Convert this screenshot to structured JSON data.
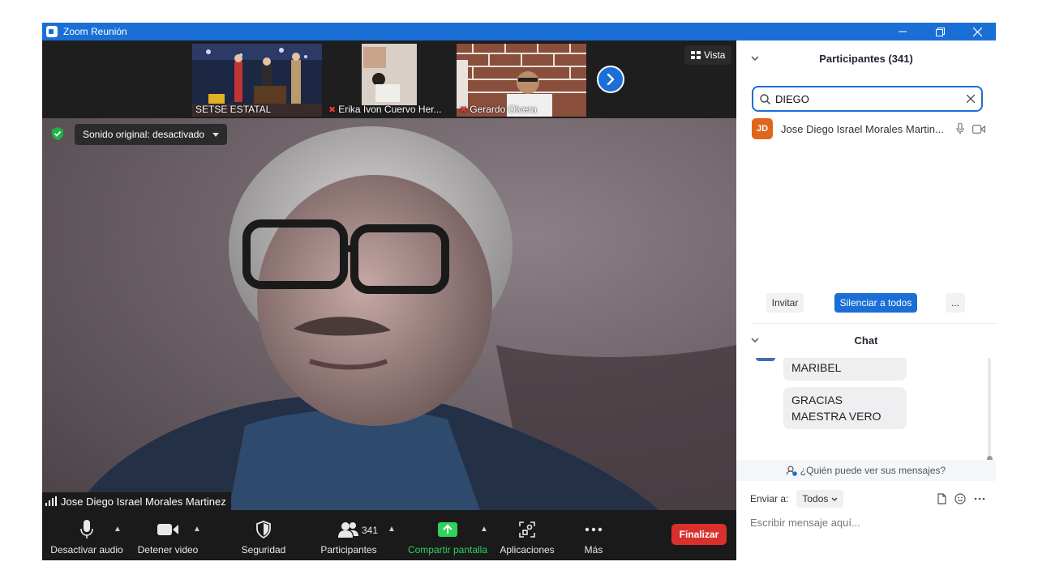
{
  "window": {
    "title": "Zoom Reunión",
    "controls": [
      "minimize",
      "restore",
      "close"
    ]
  },
  "gallery": {
    "thumbnails": [
      {
        "name": "SETSE ESTATAL",
        "muted": false
      },
      {
        "name": "Erika Ivon Cuervo Her...",
        "muted": true
      },
      {
        "name": "Gerardo Olvera",
        "muted": true
      }
    ],
    "next_icon": "chevron-right-icon",
    "view_label": "Vista"
  },
  "main_video": {
    "sound_label": "Sonido original: desactivado",
    "speaker_name": "Jose Diego Israel Morales Martinez"
  },
  "toolbar": {
    "audio_label": "Desactivar audio",
    "video_label": "Detener video",
    "security_label": "Seguridad",
    "participants_label": "Participantes",
    "participants_count": "341",
    "share_label": "Compartir pantalla",
    "apps_label": "Aplicaciones",
    "more_label": "Más",
    "end_label": "Finalizar",
    "share_color": "#2fd35b",
    "end_color": "#d9302d"
  },
  "participants_panel": {
    "title": "Participantes (341)",
    "search_value": "DIEGO",
    "items": [
      {
        "initials": "JD",
        "name": "Jose Diego Israel Morales Martin...",
        "avatar_color": "#e0661c"
      }
    ],
    "invite_label": "Invitar",
    "mute_all_label": "Silenciar a todos",
    "more_label": "..."
  },
  "chat": {
    "title": "Chat",
    "messages": [
      "MARIBEL",
      "GRACIAS MAESTRA VERO"
    ],
    "who_can_see": "¿Quién puede ver sus mensajes?",
    "send_to_label": "Enviar a:",
    "send_to_value": "Todos",
    "input_placeholder": "Escribir mensaje aquí..."
  },
  "colors": {
    "accent": "#1a6fd6",
    "toolbar_bg": "#1a1a1a"
  }
}
